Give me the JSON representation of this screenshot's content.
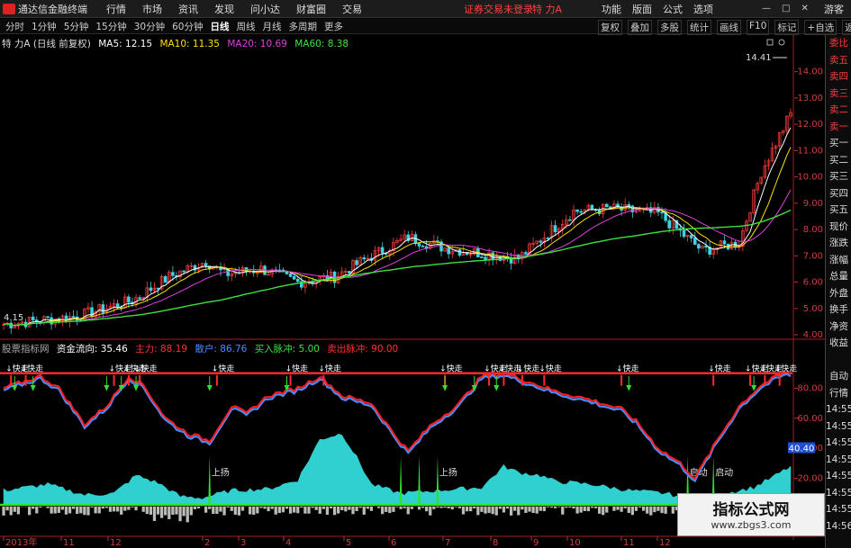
{
  "app": {
    "title": "通达信金融终端",
    "menu": [
      "行情",
      "市场",
      "资讯",
      "发现",
      "问小达",
      "财富圈",
      "交易"
    ],
    "login_notice": "证券交易未登录",
    "stock_name": "特 力A",
    "right_menu": [
      "功能",
      "版面",
      "公式",
      "选项"
    ],
    "guest_label": "游客",
    "window_controls": [
      "—",
      "□",
      "✕"
    ]
  },
  "toolbar": {
    "periods": [
      "分时",
      "1分钟",
      "5分钟",
      "15分钟",
      "30分钟",
      "60分钟",
      "日线",
      "周线",
      "月线",
      "多周期",
      "更多"
    ],
    "active_period": "日线",
    "tools": [
      "复权",
      "叠加",
      "多股",
      "统计",
      "画线",
      "F10",
      "标记",
      "+自选",
      "返回"
    ]
  },
  "main_chart": {
    "stock_label": "特 力A (日线 前复权)",
    "ma_labels": [
      {
        "text": "MA5: 12.15",
        "color": "#ffffff"
      },
      {
        "text": "MA10: 11.35",
        "color": "#ffe000"
      },
      {
        "text": "MA20: 10.69",
        "color": "#e040e0"
      },
      {
        "text": "MA60: 8.38",
        "color": "#40e040"
      }
    ],
    "price_ticks": [
      "14.00",
      "13.00",
      "12.00",
      "11.00",
      "10.00",
      "9.00",
      "8.00",
      "7.00",
      "6.00",
      "5.00",
      "4.00"
    ],
    "high_label": "14.41",
    "low_label": "4.15"
  },
  "indicator": {
    "source": "股票指标网",
    "labels": [
      {
        "text": "资金流向: 35.46",
        "color": "#ffffff"
      },
      {
        "text": "主力: 88.19",
        "color": "#ff3030"
      },
      {
        "text": "散户: 86.76",
        "color": "#4a8cff"
      },
      {
        "text": "买入脉冲: 5.00",
        "color": "#40e040"
      },
      {
        "text": "卖出脉冲: 90.00",
        "color": "#ff3030"
      }
    ],
    "ticks": [
      "80.00",
      "60.00",
      "40.00",
      "20.00"
    ],
    "current_value": "40.40",
    "run_label": "↓快走",
    "rise_label": "上扬",
    "start_label": "启动"
  },
  "right_panel": {
    "corner": "L 800",
    "items": [
      "委比",
      "卖五",
      "卖四",
      "卖三",
      "卖二",
      "卖一",
      "买一",
      "买二",
      "买三",
      "买四",
      "买五",
      "现价",
      "涨跌",
      "涨幅",
      "总量",
      "外盘",
      "换手",
      "净资",
      "收益",
      "",
      "自动",
      "行情",
      "14:55",
      "14:55",
      "14:55",
      "14:55",
      "14:55",
      "14:55",
      "14:55",
      "14:56"
    ]
  },
  "time_axis": [
    "2013年",
    "11",
    "12",
    "2",
    "3",
    "4",
    "5",
    "6",
    "7",
    "8",
    "9",
    "10",
    "11",
    "12"
  ],
  "watermark": {
    "line1": "指标公式网",
    "line2": "www.zbgs3.com"
  },
  "chart_data": {
    "type": "line",
    "price_range": [
      4.0,
      14.41
    ],
    "indicator_range": [
      0,
      100
    ]
  }
}
